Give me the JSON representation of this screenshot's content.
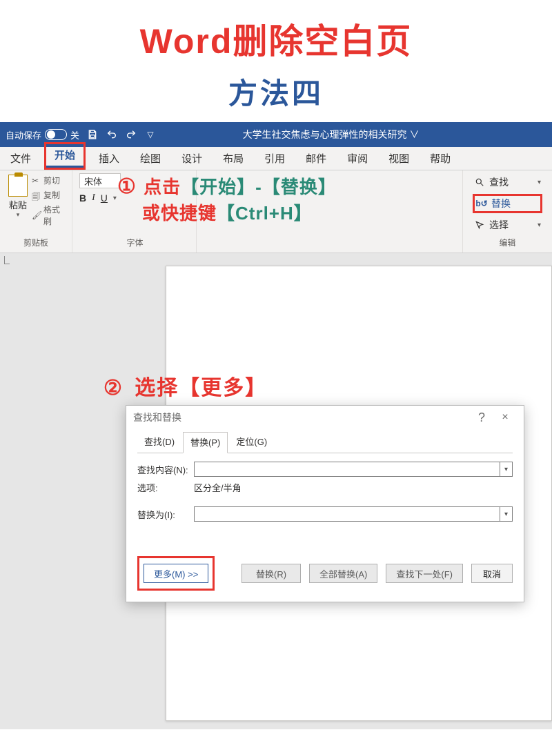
{
  "header": {
    "main_title": "Word删除空白页",
    "sub_title": "方法四"
  },
  "titlebar": {
    "autosave_label": "自动保存",
    "autosave_state": "关",
    "doc_title": "大学生社交焦虑与心理弹性的相关研究 ∨"
  },
  "ribbon_tabs": {
    "file": "文件",
    "home": "开始",
    "insert": "插入",
    "draw": "绘图",
    "design": "设计",
    "layout": "布局",
    "references": "引用",
    "mail": "邮件",
    "review": "审阅",
    "view": "视图",
    "help": "帮助"
  },
  "clipboard": {
    "paste": "粘贴",
    "cut": "剪切",
    "copy": "复制",
    "format_painter": "格式刷",
    "group_label": "剪贴板"
  },
  "font": {
    "name": "宋体",
    "b": "B",
    "i": "I",
    "u": "U",
    "group_label": "字体"
  },
  "step1": {
    "circle": "①",
    "line1_a": "点击",
    "line1_b": "【开始】-【替换】",
    "line2_a": "或快捷键",
    "line2_b": "【Ctrl+H】"
  },
  "editing": {
    "find": "查找",
    "replace": "替换",
    "select": "选择",
    "group_label": "编辑"
  },
  "step2": {
    "circle": "②",
    "text": "选择【更多】"
  },
  "dialog": {
    "title": "查找和替换",
    "help": "?",
    "close": "×",
    "tabs": {
      "find": "查找(D)",
      "replace": "替换(P)",
      "goto": "定位(G)"
    },
    "find_label": "查找内容(N):",
    "options_label": "选项:",
    "options_value": "区分全/半角",
    "replace_label": "替换为(I):",
    "buttons": {
      "more": "更多(M) >>",
      "replace": "替换(R)",
      "replace_all": "全部替换(A)",
      "find_next": "查找下一处(F)",
      "cancel": "取消"
    }
  }
}
